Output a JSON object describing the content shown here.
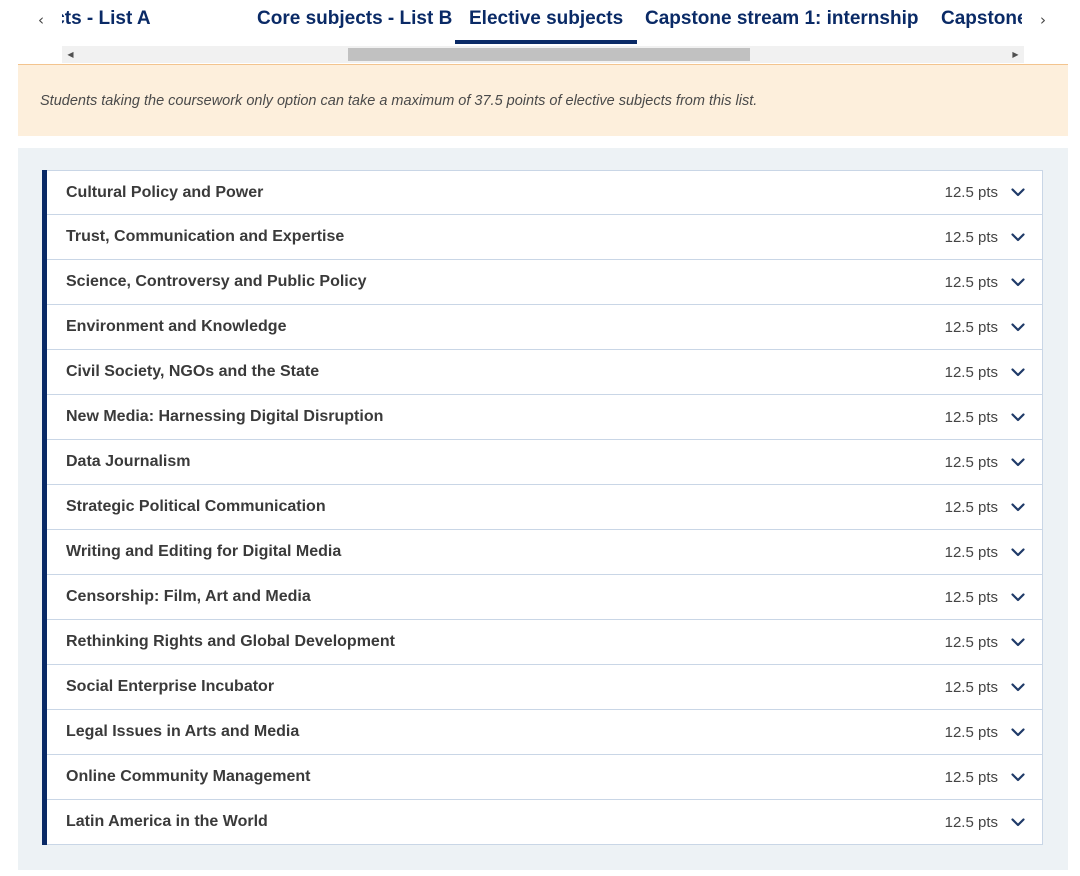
{
  "tabs": {
    "prev_icon": "chevron-left-icon",
    "next_icon": "chevron-right-icon",
    "items": [
      {
        "label": "Core subjects - List A",
        "active": false
      },
      {
        "label": "Core subjects - List B",
        "active": false
      },
      {
        "label": "Elective subjects",
        "active": true
      },
      {
        "label": "Capstone stream 1: internship",
        "active": false
      },
      {
        "label": "Capstone",
        "active": false
      }
    ]
  },
  "notice": {
    "text": "Students taking the coursework only option can take a maximum of 37.5 points of elective subjects from this list."
  },
  "subjects": [
    {
      "title": "Cultural Policy and Power",
      "points": "12.5 pts"
    },
    {
      "title": "Trust, Communication and Expertise",
      "points": "12.5 pts"
    },
    {
      "title": "Science, Controversy and Public Policy",
      "points": "12.5 pts"
    },
    {
      "title": "Environment and Knowledge",
      "points": "12.5 pts"
    },
    {
      "title": "Civil Society, NGOs and the State",
      "points": "12.5 pts"
    },
    {
      "title": "New Media: Harnessing Digital Disruption",
      "points": "12.5 pts"
    },
    {
      "title": "Data Journalism",
      "points": "12.5 pts"
    },
    {
      "title": "Strategic Political Communication",
      "points": "12.5 pts"
    },
    {
      "title": "Writing and Editing for Digital Media",
      "points": "12.5 pts"
    },
    {
      "title": "Censorship: Film, Art and Media",
      "points": "12.5 pts"
    },
    {
      "title": "Rethinking Rights and Global Development",
      "points": "12.5 pts"
    },
    {
      "title": "Social Enterprise Incubator",
      "points": "12.5 pts"
    },
    {
      "title": "Legal Issues in Arts and Media",
      "points": "12.5 pts"
    },
    {
      "title": "Online Community Management",
      "points": "12.5 pts"
    },
    {
      "title": "Latin America in the World",
      "points": "12.5 pts"
    }
  ],
  "colors": {
    "accent": "#0a2a66",
    "notice_bg": "#fdefdc",
    "panel_bg": "#edf2f5"
  }
}
